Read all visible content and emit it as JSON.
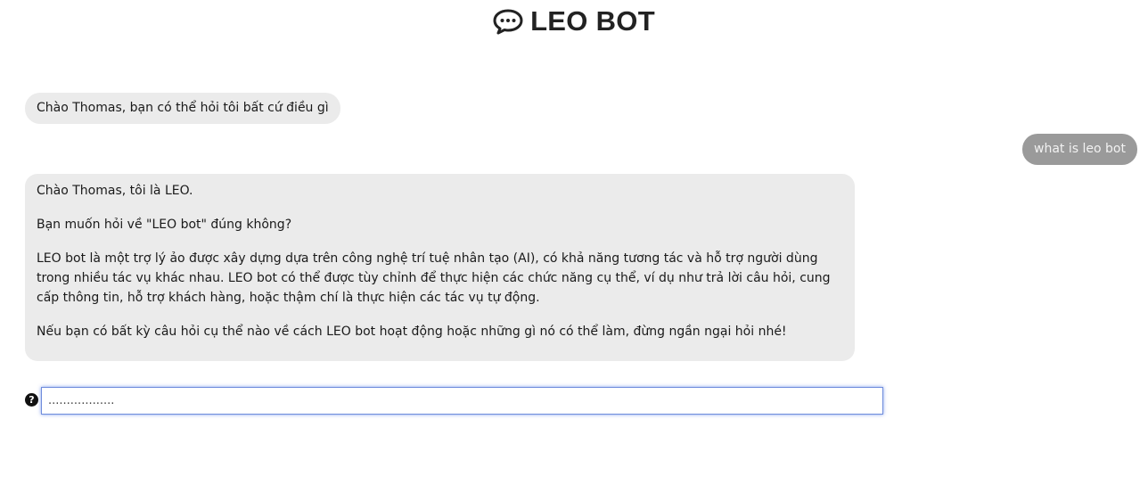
{
  "header": {
    "title": "LEO BOT",
    "icon": "chat-bubble-icon"
  },
  "conversation": {
    "greeting": "Chào Thomas, bạn có thể hỏi tôi bất cứ điều gì",
    "user_message": "what is leo bot",
    "answer": {
      "p1": "Chào Thomas, tôi là LEO.",
      "p2": "Bạn muốn hỏi về \"LEO bot\" đúng không?",
      "p3": "LEO bot là một trợ lý ảo được xây dựng dựa trên công nghệ trí tuệ nhân tạo (AI), có khả năng tương tác và hỗ trợ người dùng trong nhiều tác vụ khác nhau. LEO bot có thể được tùy chỉnh để thực hiện các chức năng cụ thể, ví dụ như trả lời câu hỏi, cung cấp thông tin, hỗ trợ khách hàng, hoặc thậm chí là thực hiện các tác vụ tự động.",
      "p4": "Nếu bạn có bất kỳ câu hỏi cụ thể nào về cách LEO bot hoạt động hoặc những gì nó có thể làm, đừng ngần ngại hỏi nhé!"
    }
  },
  "input": {
    "placeholder": "..................",
    "value": "",
    "icon": "question-circle-icon",
    "icon_glyph": "?"
  },
  "colors": {
    "bot_bubble": "#ebebeb",
    "user_bubble": "#9a9a9a",
    "input_focus_border": "#6f8cdc"
  }
}
